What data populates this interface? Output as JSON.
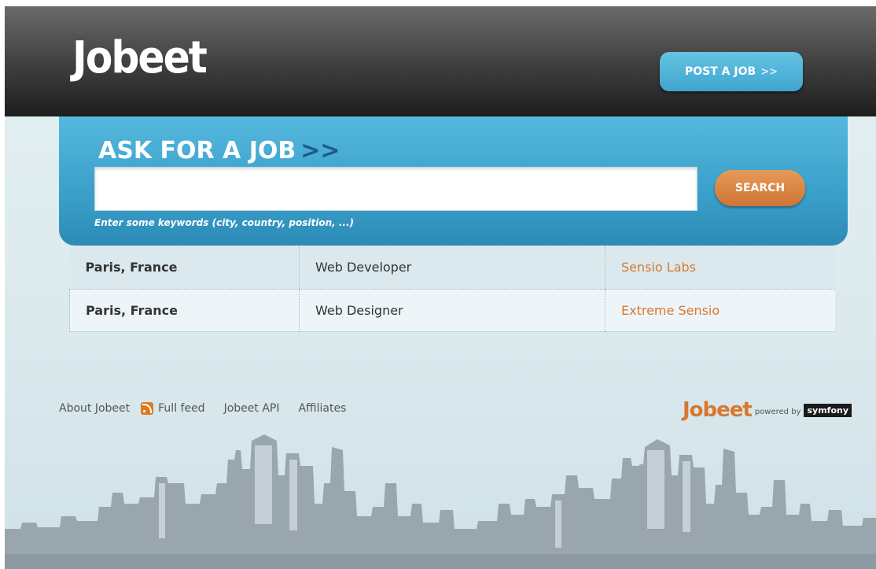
{
  "header": {
    "logo_text": "Jobeet",
    "post_job_label": "POST A JOB",
    "post_job_chevron": ">>"
  },
  "search": {
    "title": "ASK FOR A JOB",
    "title_chevron": ">>",
    "input_value": "",
    "button_label": "SEARCH",
    "help_text": "Enter some keywords (city, country, position, ...)"
  },
  "jobs": [
    {
      "location": "Paris, France",
      "position": "Web Developer",
      "company": "Sensio Labs"
    },
    {
      "location": "Paris, France",
      "position": "Web Designer",
      "company": "Extreme Sensio"
    }
  ],
  "footer": {
    "links": [
      "About Jobeet",
      "Full feed",
      "Jobeet API",
      "Affiliates"
    ],
    "logo_text": "Jobeet",
    "powered_by": "powered by",
    "symfony": "symfony"
  },
  "colors": {
    "accent_blue": "#3ea5cf",
    "accent_orange": "#d8782f",
    "header_dark": "#2e2e2e"
  }
}
